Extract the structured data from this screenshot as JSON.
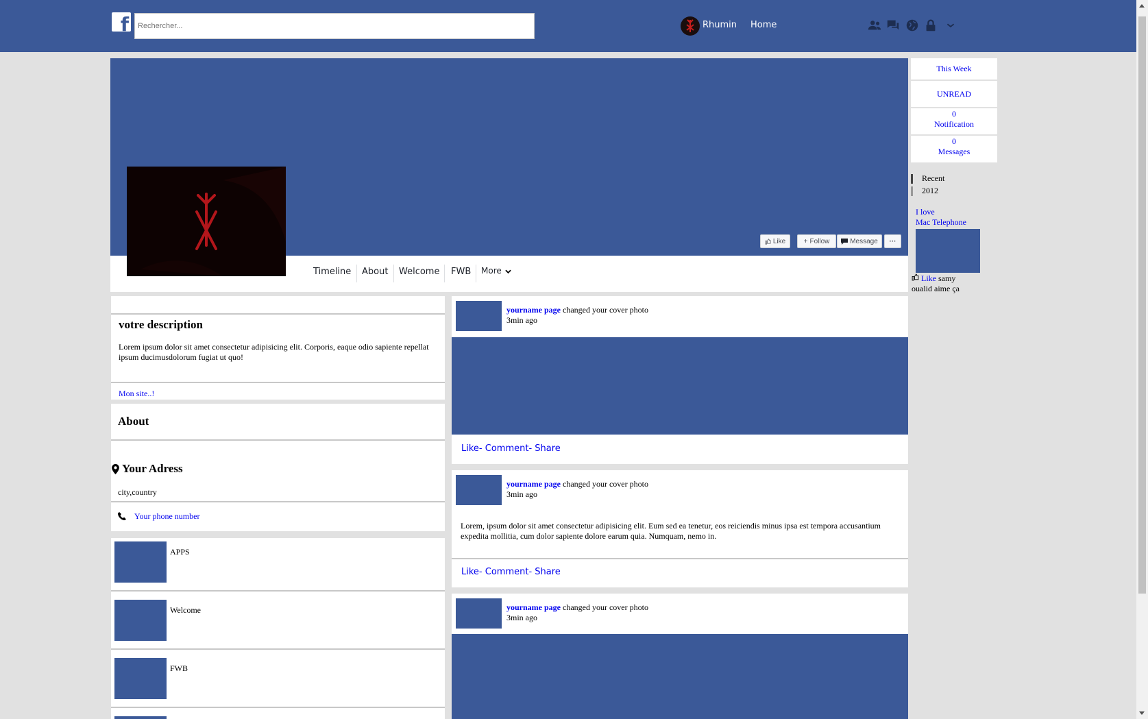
{
  "header": {
    "logo_letter": "f",
    "search_placeholder": "Rechercher...",
    "user_name": "Rhumin",
    "home_label": "Home",
    "icons": [
      "friends-icon",
      "messages-icon",
      "globe-icon",
      "lock-icon",
      "chevron-down-icon"
    ]
  },
  "profile_actions": {
    "like": "Like",
    "follow": "Follow",
    "message": "Message",
    "more": "···"
  },
  "profile_tabs": [
    "Timeline",
    "About",
    "Welcome",
    "FWB",
    "More"
  ],
  "sidebar": {
    "this_week": "This Week",
    "unread": "UNREAD",
    "notif_count": "0",
    "notif_label": "Notification",
    "msg_count": "0",
    "msg_label": "Messages",
    "timeline": [
      "Recent",
      "2012"
    ],
    "ad_line1": "I love",
    "ad_line2": "Mac Telephone",
    "like_label": "Like",
    "like_text1": "samy",
    "like_text2": "oualid aime ça"
  },
  "left": {
    "desc_title": "votre description",
    "desc_text": "Lorem ipsum dolor sit amet consectetur adipisicing elit. Corporis, eaque odio sapiente repellat ipsum ducimusdolorum fugiat ut quo!",
    "site_link": "Mon site..!",
    "about_title": "About",
    "address_title": "Your Adress",
    "address_value": "city,country",
    "phone_link": "Your phone number",
    "apps": [
      "APPS",
      "Welcome",
      "FWB"
    ]
  },
  "feed": {
    "posts": [
      {
        "author": "yourname page",
        "action": "changed your cover photo",
        "time": "3min ago",
        "text": ""
      },
      {
        "author": "yourname page",
        "action": "changed your cover photo",
        "time": "3min ago",
        "text": "Lorem, ipsum dolor sit amet consectetur adipisicing elit. Eum sed ea tenetur, eos reiciendis minus ipsa est tempora accusantium expedita mollitia, cum dolor sapiente dolore earum quia. Numquam, nemo in."
      },
      {
        "author": "yourname page",
        "action": "changed your cover photo",
        "time": "3min ago",
        "text": ""
      }
    ],
    "like": "Like",
    "comment": "- Comment",
    "share": "- Share"
  },
  "colors": {
    "brand": "#3b5998",
    "link": "#0000ee",
    "page_bg": "#e1e1e1"
  }
}
